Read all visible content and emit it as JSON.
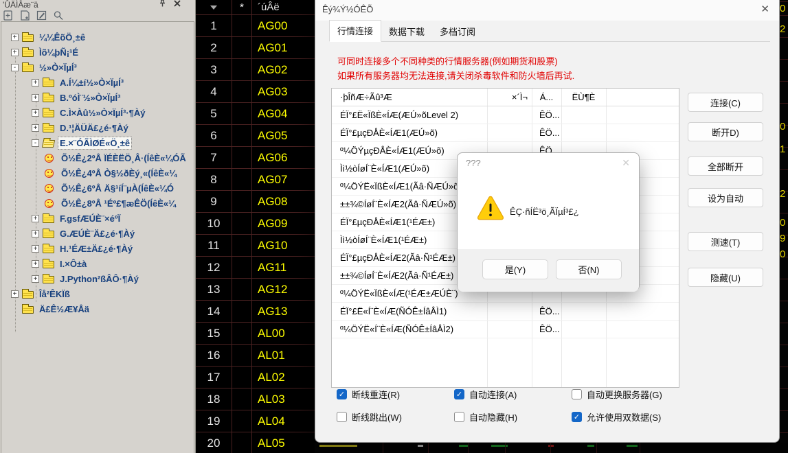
{
  "left_panel": {
    "title": "'ÛÄÌÂæ¨ä",
    "titlebar_icons": [
      "pin-icon",
      "close-icon"
    ],
    "toolbar_icons": [
      "new-file-icon",
      "add-page-icon",
      "edit-icon",
      "search-icon"
    ],
    "tree": [
      {
        "label": "¼¼ÊõÖ¸±ê",
        "level": 0,
        "expander": "+",
        "icon": "folder"
      },
      {
        "label": "Ìõ¼þÑ¡¹É",
        "level": 0,
        "expander": "+",
        "icon": "folder"
      },
      {
        "label": "½»Ò×ÏµÍ³",
        "level": 0,
        "expander": "-",
        "icon": "folder"
      },
      {
        "label": "A.Í¼±í½»Ò×ÏµÍ³",
        "level": 1,
        "expander": "+",
        "icon": "folder"
      },
      {
        "label": "B.ºóÌ¨½»Ò×ÏµÍ³",
        "level": 1,
        "expander": "+",
        "icon": "folder"
      },
      {
        "label": "C.Ì×Àû½»Ò×ÏµÍ³·¶Àý",
        "level": 1,
        "expander": "+",
        "icon": "folder"
      },
      {
        "label": "D.¹¦ÄÜÄ£¿é·¶Àý",
        "level": 1,
        "expander": "+",
        "icon": "folder"
      },
      {
        "label": "E.×¨ÓÃÌØÉ«Ö¸±ê",
        "level": 1,
        "expander": "-",
        "icon": "folder-open",
        "selected": true
      },
      {
        "label": "Õ½Ê¿2ºÅ   ÏÉÈËÖ¸Â·(ÍêÈ«¼ÓÃ",
        "level": 2,
        "expander": "",
        "icon": "smiley"
      },
      {
        "label": "Õ½Ê¿4ºÅ   Ò§½ðÈý¸«(ÍêÈ«¼",
        "level": 2,
        "expander": "",
        "icon": "smiley"
      },
      {
        "label": "Õ½Ê¿6ºÅ   Ä§¹íÍ¨µÀ(ÍêÈ«¼Ó",
        "level": 2,
        "expander": "",
        "icon": "smiley"
      },
      {
        "label": "Õ½Ê¿8ºÅ   ¹Éº£¶æÊÖ(ÍêÈ«¼",
        "level": 2,
        "expander": "",
        "icon": "smiley"
      },
      {
        "label": "F.gsfÆÚÈ¨×éºÏ",
        "level": 1,
        "expander": "+",
        "icon": "folder"
      },
      {
        "label": "G.ÆÚÈ¨Ä£¿é·¶Àý",
        "level": 1,
        "expander": "+",
        "icon": "folder"
      },
      {
        "label": "H.¹ÉÆ±Ä£¿é·¶Àý",
        "level": 1,
        "expander": "+",
        "icon": "folder"
      },
      {
        "label": "I.×Ô±à",
        "level": 1,
        "expander": "+",
        "icon": "folder"
      },
      {
        "label": "J.Python²ßÂÔ·¶Àý",
        "level": 1,
        "expander": "+",
        "icon": "folder"
      },
      {
        "label": "Îå²ÊKÏß",
        "level": 0,
        "expander": "+",
        "icon": "folder"
      },
      {
        "label": "Ä£Ê½Æ¥Åä",
        "level": 0,
        "expander": "",
        "icon": "folder"
      }
    ]
  },
  "quote_table": {
    "header": {
      "sort_icon": "sort-down-icon",
      "star": "*",
      "code_col": "´úÂë"
    },
    "rows": [
      {
        "num": "1",
        "code": "AG00"
      },
      {
        "num": "2",
        "code": "AG01"
      },
      {
        "num": "3",
        "code": "AG02"
      },
      {
        "num": "4",
        "code": "AG03"
      },
      {
        "num": "5",
        "code": "AG04"
      },
      {
        "num": "6",
        "code": "AG05"
      },
      {
        "num": "7",
        "code": "AG06"
      },
      {
        "num": "8",
        "code": "AG07"
      },
      {
        "num": "9",
        "code": "AG08"
      },
      {
        "num": "10",
        "code": "AG09"
      },
      {
        "num": "11",
        "code": "AG10"
      },
      {
        "num": "12",
        "code": "AG11"
      },
      {
        "num": "13",
        "code": "AG12"
      },
      {
        "num": "14",
        "code": "AG13"
      },
      {
        "num": "15",
        "code": "AL00"
      },
      {
        "num": "16",
        "code": "AL01"
      },
      {
        "num": "17",
        "code": "AL02"
      },
      {
        "num": "18",
        "code": "AL03"
      },
      {
        "num": "19",
        "code": "AL04"
      },
      {
        "num": "20",
        "code": "AL05"
      }
    ]
  },
  "right_strip": {
    "digit_fragments": [
      "0",
      "2",
      "0",
      "1",
      "2",
      "0",
      "9",
      "0"
    ]
  },
  "dialog": {
    "title": "Êý¾Ý½ÓÊÕ",
    "close_icon": "close-icon",
    "tabs": [
      {
        "label": "行情连接",
        "active": true
      },
      {
        "label": "数据下载",
        "active": false
      },
      {
        "label": "多档订阅",
        "active": false
      }
    ],
    "warning_lines": [
      "可同时连接多个不同种类的行情服务器(例如期货和股票)",
      "如果所有服务器均无法连接,请关闭杀毒软件和防火墙后再试."
    ],
    "server_list": {
      "columns": {
        "name": "·þÎñÆ÷Ãû³Æ",
        "state": "×´Ì¬",
        "conn": "Á...",
        "speed": "ËÙ¶È"
      },
      "rows": [
        {
          "name": "ÉÏ°£Ë«ÏßÈ«ÍÆ(ÆÚ»õLevel 2)",
          "conn": "ÊÖ..."
        },
        {
          "name": "ÉÏ°£µçÐÅÈ«ÍÆ1(ÆÚ»õ)",
          "conn": "ÊÖ..."
        },
        {
          "name": "º¼ÖÝµçÐÅÈ«ÍÆ1(ÆÚ»õ)",
          "conn": "ÊÖ..."
        },
        {
          "name": "Ìì½òÍøÍ¨È«ÍÆ1(ÆÚ»õ)",
          "conn": ""
        },
        {
          "name": "º¼ÖÝË«ÏßÈ«ÍÆ1(Ãâ·ÑÆÚ»õ)",
          "conn": ""
        },
        {
          "name": "±±¾©ÍøÍ¨È«ÍÆ2(Ãâ·ÑÆÚ»õ)",
          "conn": ""
        },
        {
          "name": "ÉÏ°£µçÐÅÈ«ÍÆ1(¹ÉÆ±)",
          "conn": ""
        },
        {
          "name": "Ìì½òÍøÍ¨È«ÍÆ1(¹ÉÆ±)",
          "conn": ""
        },
        {
          "name": "ÉÏ°£µçÐÅÈ«ÍÆ2(Ãâ·Ñ¹ÉÆ±)",
          "conn": ""
        },
        {
          "name": "±±¾©ÍøÍ¨È«ÍÆ2(Ãâ·Ñ¹ÉÆ±)",
          "conn": ""
        },
        {
          "name": "º¼ÖÝË«ÏßÈ«ÍÆ(¹ÉÆ±ÆÚÈ¨)",
          "conn": ""
        },
        {
          "name": "ÉÏ°£Ë«Í¨È«ÍÆ(ÑÓÊ±ÍâÅÌ1)",
          "conn": "ÊÖ..."
        },
        {
          "name": "º¼ÖÝË«Í¨È«ÍÆ(ÑÓÊ±ÍâÅÌ2)",
          "conn": "ÊÖ..."
        }
      ]
    },
    "checkboxes": [
      {
        "label": "断线重连(R)",
        "checked": true
      },
      {
        "label": "自动连接(A)",
        "checked": true
      },
      {
        "label": "自动更换服务器(G)",
        "checked": false
      },
      {
        "label": "断线跳出(W)",
        "checked": false
      },
      {
        "label": "自动隐藏(H)",
        "checked": false
      },
      {
        "label": "允许使用双数据(S)",
        "checked": true
      }
    ],
    "buttons": [
      "连接(C)",
      "断开D)",
      "全部断开",
      "设为自动",
      "测速(T)",
      "隐藏(U)"
    ],
    "accent_colors": {
      "warning_text": "#e10000",
      "checkbox_checked": "#1467c8"
    }
  },
  "modal": {
    "title": "???",
    "close_icon": "close-icon",
    "warning_icon": "warning-triangle-icon",
    "message": "ÊÇ·ñÍË³ö¸ÃÏµÍ³£¿",
    "yes_label": "是(Y)",
    "no_label": "否(N)"
  },
  "app_colors": {
    "table_bg": "#000000",
    "table_grid": "#4a2121",
    "code_text": "#ffff00",
    "tree_text": "#17407e"
  }
}
